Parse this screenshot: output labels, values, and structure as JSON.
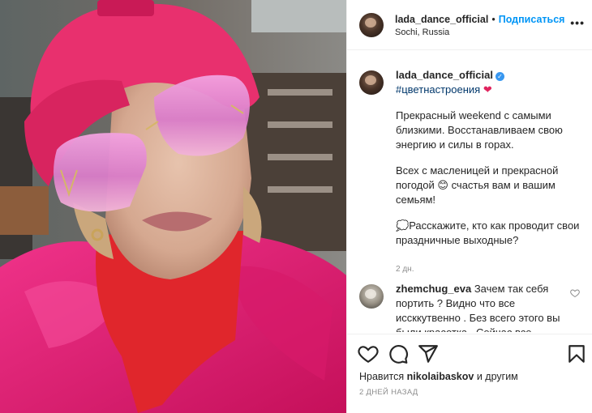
{
  "post": {
    "username": "lada_dance_official",
    "follow_label": "Подписаться",
    "location": "Sochi, Russia",
    "more_label": "•••"
  },
  "caption": {
    "username": "lada_dance_official",
    "hashtag": "#цветнастроения",
    "hashtag_emoji": "❤",
    "para1": "Прекрасный weekend с самыми близкими. Восстанавливаем свою энергию и силы в горах.",
    "para2_a": "Всех с масленицей и прекрасной погодой",
    "para2_emoji": "😊",
    "para2_b": "счастья вам и вашим семьям!",
    "para3_emoji": "💭",
    "para3": "Расскажите, кто как проводит свои праздничные выходные?",
    "age": "2 дн."
  },
  "comment": {
    "username": "zhemchug_eva",
    "text": "Зачем так себя портить ? Видно что все иссккутвенно . Без всего этого вы были красотка . Сейчас все"
  },
  "likes": {
    "prefix": "Нравится",
    "user": "nikolaibaskov",
    "suffix": "и другим"
  },
  "posted": "2 ДНЕЙ НАЗАД",
  "colors": {
    "accent": "#0095f6",
    "hat": "#e8306e",
    "coat": "#e21f6d",
    "lenses": "#e98ed0"
  },
  "icons": {
    "like": "heart-outline-icon",
    "comment": "comment-bubble-icon",
    "share": "paper-plane-icon",
    "save": "bookmark-icon"
  }
}
